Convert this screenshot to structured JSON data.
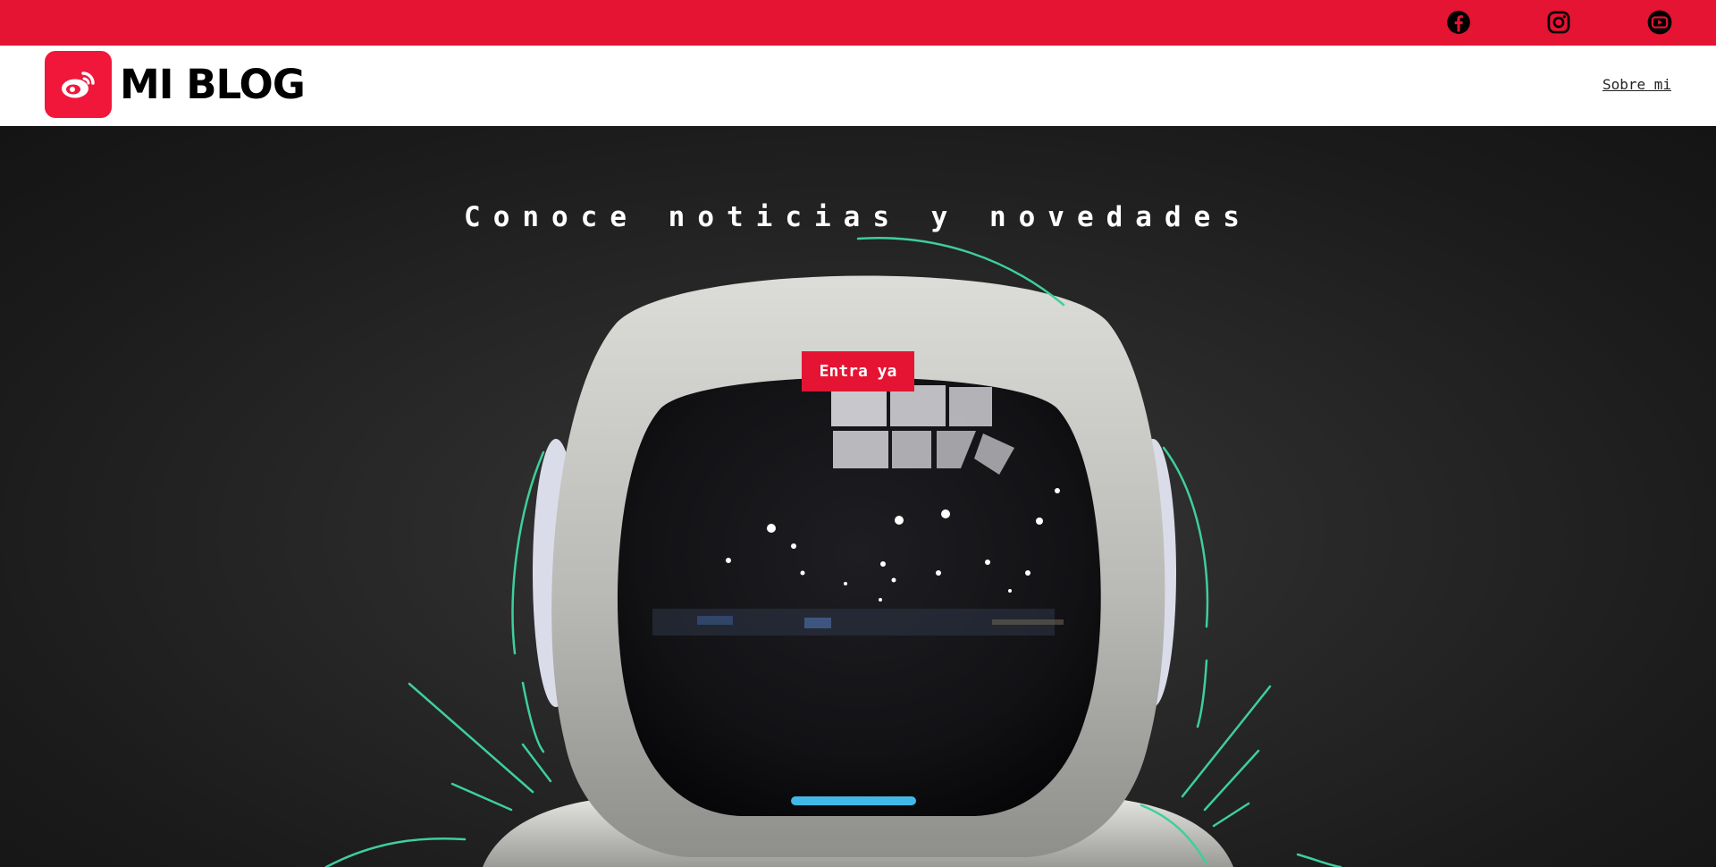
{
  "topbar": {
    "color": "#e51433",
    "social": [
      {
        "icon": "facebook-icon"
      },
      {
        "icon": "instagram-icon"
      },
      {
        "icon": "youtube-icon"
      }
    ]
  },
  "header": {
    "logo_icon": "weibo-icon",
    "logo_text": "MI BLOG",
    "nav": {
      "about_label": "Sobre mi"
    }
  },
  "hero": {
    "title": "Conoce noticias y novedades",
    "cta_label": "Entra ya",
    "accent": "#e51433",
    "line_color": "#3ecf9a"
  }
}
